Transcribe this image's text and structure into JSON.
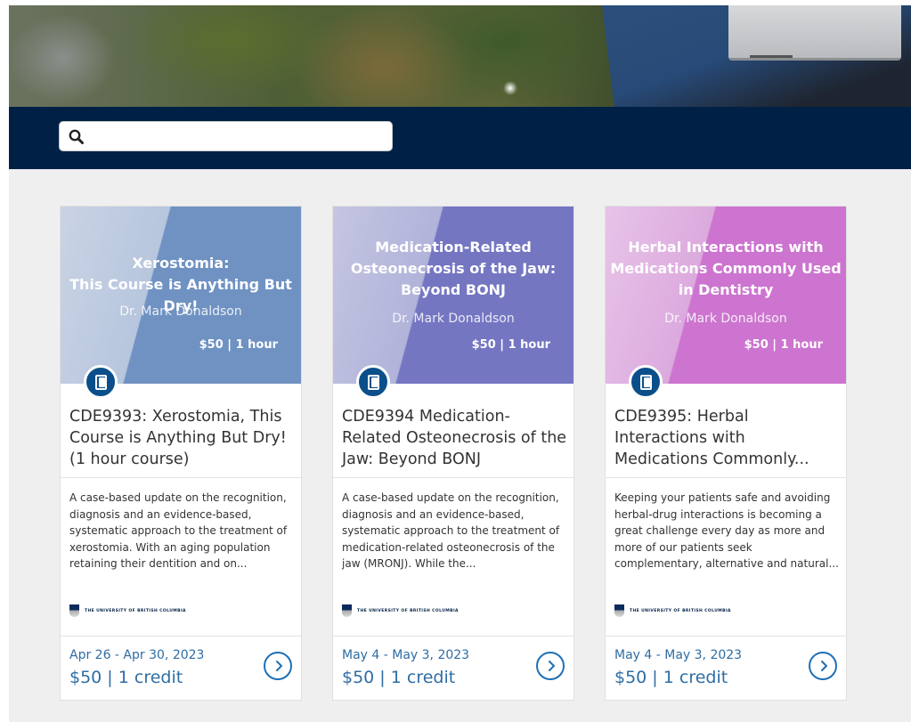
{
  "search": {
    "placeholder": "",
    "value": ""
  },
  "colors": {
    "nav_bg": "#002145",
    "link": "#2e6da4",
    "badge": "#0b4f8a"
  },
  "courses": [
    {
      "banner_title_lines": [
        "Xerostomia:",
        "This Course is Anything But Dry!"
      ],
      "banner_instructor": "Dr. Mark Donaldson",
      "banner_price": "$50  |  1 hour",
      "title": "CDE9393: Xerostomia, This Course is Anything But Dry! (1 hour course)",
      "description": "A case-based update on the recognition, diagnosis and an evidence-based, systematic approach to the treatment of xerostomia. With an aging population retaining their dentition and on...",
      "provider": "THE UNIVERSITY OF BRITISH COLUMBIA",
      "dates": "Apr 26 - Apr 30, 2023",
      "price_credit": "$50 | 1 credit",
      "banner_color": "#5b7fb3"
    },
    {
      "banner_title_lines": [
        "Medication-Related",
        "Osteonecrosis of the Jaw:",
        "Beyond BONJ"
      ],
      "banner_instructor": "Dr. Mark Donaldson",
      "banner_price": "$50  |  1 hour",
      "title": "CDE9394 Medication-Related Osteonecrosis of the Jaw: Beyond BONJ",
      "description": "A case-based update on the recognition, diagnosis and an evidence-based, systematic approach to the treatment of medication-related osteonecrosis of the jaw (MRONJ). While the...",
      "provider": "THE UNIVERSITY OF BRITISH COLUMBIA",
      "dates": "May 4 - May 3, 2023",
      "price_credit": "$50 | 1 credit",
      "banner_color": "#6e6fbb"
    },
    {
      "banner_title_lines": [
        "Herbal Interactions with",
        "Medications Commonly Used",
        "in Dentistry"
      ],
      "banner_instructor": "Dr. Mark Donaldson",
      "banner_price": "$50  |  1 hour",
      "title": "CDE9395: Herbal Interactions with Medications Commonly...",
      "description": "Keeping your patients safe and avoiding herbal-drug interactions is becoming a great challenge every day as more and more of our patients seek complementary, alternative and natural...",
      "provider": "THE UNIVERSITY OF BRITISH COLUMBIA",
      "dates": "May 4 - May 3, 2023",
      "price_credit": "$50 | 1 credit",
      "banner_color": "#c46bc8"
    }
  ]
}
